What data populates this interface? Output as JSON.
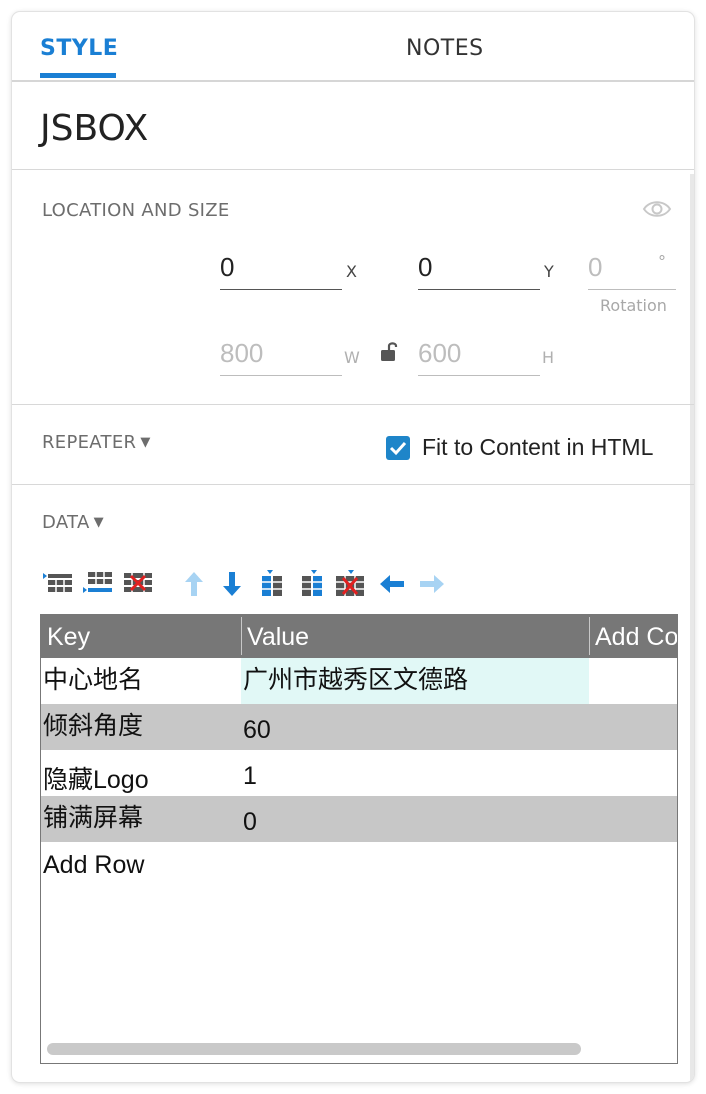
{
  "tabs": {
    "style": "STYLE",
    "notes": "NOTES"
  },
  "widget_name": "JSBOX",
  "location": {
    "section_label": "LOCATION AND SIZE",
    "x": {
      "value": "0",
      "label": "X"
    },
    "y": {
      "value": "0",
      "label": "Y"
    },
    "rotation": {
      "value": "0",
      "unit": "°",
      "label": "Rotation"
    },
    "w": {
      "value": "800",
      "label": "W"
    },
    "h": {
      "value": "600",
      "label": "H"
    }
  },
  "repeater": {
    "section_label": "REPEATER",
    "fit_to_content_label": "Fit to Content in HTML",
    "fit_to_content_checked": true
  },
  "data": {
    "section_label": "DATA",
    "toolbar_icons": [
      "insert-row-above-icon",
      "insert-row-below-icon",
      "delete-row-icon",
      "move-up-icon",
      "move-down-icon",
      "insert-column-left-icon",
      "insert-column-right-icon",
      "delete-column-icon",
      "move-left-icon",
      "move-right-icon"
    ],
    "columns": [
      "Key",
      "Value",
      "Add Co"
    ],
    "rows": [
      {
        "key": "中心地名",
        "value": "广州市越秀区文德路"
      },
      {
        "key": "倾斜角度",
        "value": "60"
      },
      {
        "key": "隐藏Logo",
        "value": "1"
      },
      {
        "key": "铺满屏幕",
        "value": "0"
      }
    ],
    "add_row_label": "Add Row"
  },
  "colors": {
    "accent": "#1a7fd4",
    "checkbox": "#1e85c9",
    "grid_header": "#777777",
    "alt_row": "#c7c7c7",
    "edit_cell": "#e1f8f6"
  }
}
